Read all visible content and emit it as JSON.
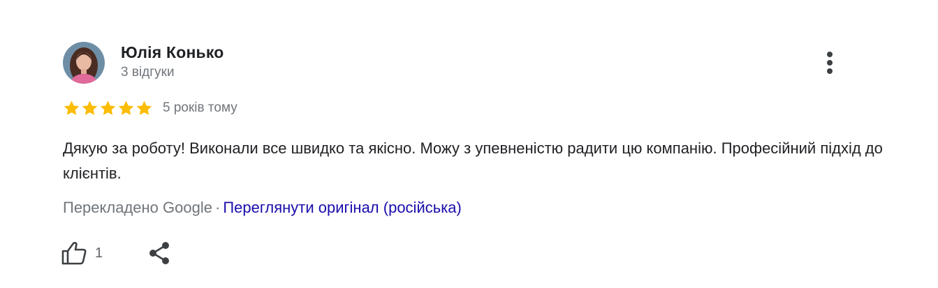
{
  "review": {
    "author": {
      "name": "Юлія Конько",
      "review_count": "3 відгуки",
      "avatar_icon": "profile-photo"
    },
    "rating": {
      "stars": 5,
      "max": 5,
      "star_color": "#fbbc04"
    },
    "date": "5 років тому",
    "text": "Дякую за роботу! Виконали все швидко та якісно. Можу з упевненістю радити цю компанію. Професійний підхід до клієнтів.",
    "translation": {
      "label": "Перекладено Google",
      "separator": "·",
      "view_original": "Переглянути оригінал (російська)"
    },
    "actions": {
      "like_count": "1",
      "like_icon": "thumb-up-icon",
      "share_icon": "share-icon",
      "more_icon": "more-vert-icon"
    }
  },
  "colors": {
    "text": "#202124",
    "secondary": "#70757a",
    "link": "#1a0dab"
  }
}
